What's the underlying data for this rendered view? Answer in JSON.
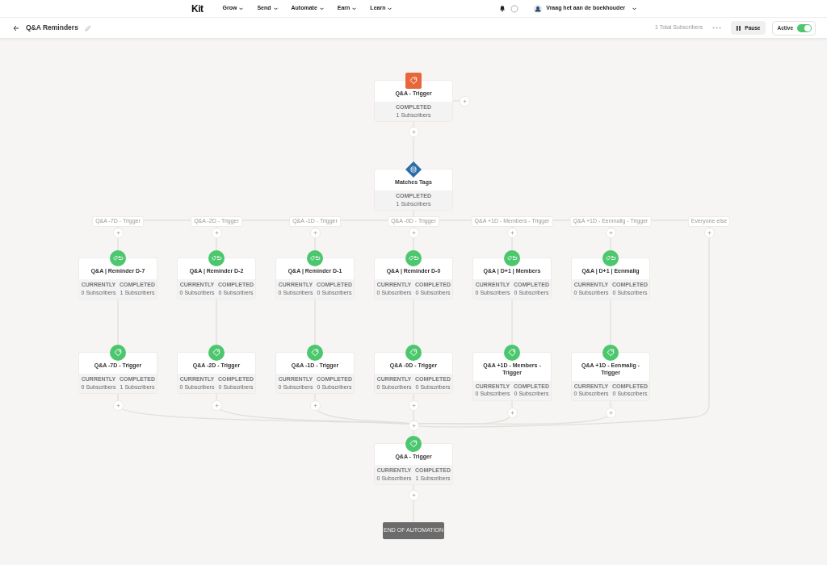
{
  "navbar": {
    "logo": "Kit",
    "menu": [
      {
        "label": "Grow"
      },
      {
        "label": "Send"
      },
      {
        "label": "Automate"
      },
      {
        "label": "Earn"
      },
      {
        "label": "Learn"
      }
    ],
    "account": "Vraag het aan de boekhouder"
  },
  "header": {
    "title": "Q&A Reminders",
    "total": "1 Total Subscribers",
    "pause": "Pause",
    "active": {
      "label": "Active",
      "on": true
    }
  },
  "start": {
    "kind": "trigger",
    "title": "Q&A - Trigger",
    "stats": [
      {
        "label": "COMPLETED",
        "value": "1 Subscribers"
      }
    ]
  },
  "condition": {
    "kind": "condition",
    "title": "Matches Tags",
    "stats": [
      {
        "label": "COMPLETED",
        "value": "1 Subscribers"
      }
    ]
  },
  "branches": [
    {
      "label": "Q&A -7D - Trigger",
      "steps": [
        {
          "kind": "sequence",
          "title": "Q&A | Reminder D-7",
          "stats": [
            {
              "label": "CURRENTLY",
              "value": "0 Subscribers"
            },
            {
              "label": "COMPLETED",
              "value": "1 Subscribers"
            }
          ]
        },
        {
          "kind": "tag",
          "title": "Q&A -7D - Trigger",
          "stats": [
            {
              "label": "CURRENTLY",
              "value": "0 Subscribers"
            },
            {
              "label": "COMPLETED",
              "value": "1 Subscribers"
            }
          ]
        }
      ]
    },
    {
      "label": "Q&A -2D - Trigger",
      "steps": [
        {
          "kind": "sequence",
          "title": "Q&A | Reminder D-2",
          "stats": [
            {
              "label": "CURRENTLY",
              "value": "0 Subscribers"
            },
            {
              "label": "COMPLETED",
              "value": "0 Subscribers"
            }
          ]
        },
        {
          "kind": "tag",
          "title": "Q&A -2D - Trigger",
          "stats": [
            {
              "label": "CURRENTLY",
              "value": "0 Subscribers"
            },
            {
              "label": "COMPLETED",
              "value": "0 Subscribers"
            }
          ]
        }
      ]
    },
    {
      "label": "Q&A -1D - Trigger",
      "steps": [
        {
          "kind": "sequence",
          "title": "Q&A | Reminder D-1",
          "stats": [
            {
              "label": "CURRENTLY",
              "value": "0 Subscribers"
            },
            {
              "label": "COMPLETED",
              "value": "0 Subscribers"
            }
          ]
        },
        {
          "kind": "tag",
          "title": "Q&A -1D - Trigger",
          "stats": [
            {
              "label": "CURRENTLY",
              "value": "0 Subscribers"
            },
            {
              "label": "COMPLETED",
              "value": "0 Subscribers"
            }
          ]
        }
      ]
    },
    {
      "label": "Q&A -0D - Trigger",
      "steps": [
        {
          "kind": "sequence",
          "title": "Q&A | Reminder D-0",
          "stats": [
            {
              "label": "CURRENTLY",
              "value": "0 Subscribers"
            },
            {
              "label": "COMPLETED",
              "value": "0 Subscribers"
            }
          ]
        },
        {
          "kind": "tag",
          "title": "Q&A -0D - Trigger",
          "stats": [
            {
              "label": "CURRENTLY",
              "value": "0 Subscribers"
            },
            {
              "label": "COMPLETED",
              "value": "0 Subscribers"
            }
          ]
        }
      ]
    },
    {
      "label": "Q&A +1D - Members - Trigger",
      "steps": [
        {
          "kind": "sequence",
          "title": "Q&A | D+1 | Members",
          "stats": [
            {
              "label": "CURRENTLY",
              "value": "0 Subscribers"
            },
            {
              "label": "COMPLETED",
              "value": "0 Subscribers"
            }
          ]
        },
        {
          "kind": "tag",
          "title": "Q&A +1D - Members - Trigger",
          "stats": [
            {
              "label": "CURRENTLY",
              "value": "0 Subscribers"
            },
            {
              "label": "COMPLETED",
              "value": "0 Subscribers"
            }
          ]
        }
      ]
    },
    {
      "label": "Q&A +1D - Eenmalig - Trigger",
      "steps": [
        {
          "kind": "sequence",
          "title": "Q&A | D+1 | Eenmalig",
          "stats": [
            {
              "label": "CURRENTLY",
              "value": "0 Subscribers"
            },
            {
              "label": "COMPLETED",
              "value": "0 Subscribers"
            }
          ]
        },
        {
          "kind": "tag",
          "title": "Q&A +1D - Eenmalig - Trigger",
          "stats": [
            {
              "label": "CURRENTLY",
              "value": "0 Subscribers"
            },
            {
              "label": "COMPLETED",
              "value": "0 Subscribers"
            }
          ]
        }
      ]
    },
    {
      "label": "Everyone else"
    }
  ],
  "final": {
    "kind": "tag",
    "title": "Q&A - Trigger",
    "stats": [
      {
        "label": "CURRENTLY",
        "value": "0 Subscribers"
      },
      {
        "label": "COMPLETED",
        "value": "1 Subscribers"
      }
    ]
  },
  "end": "END OF AUTOMATION"
}
